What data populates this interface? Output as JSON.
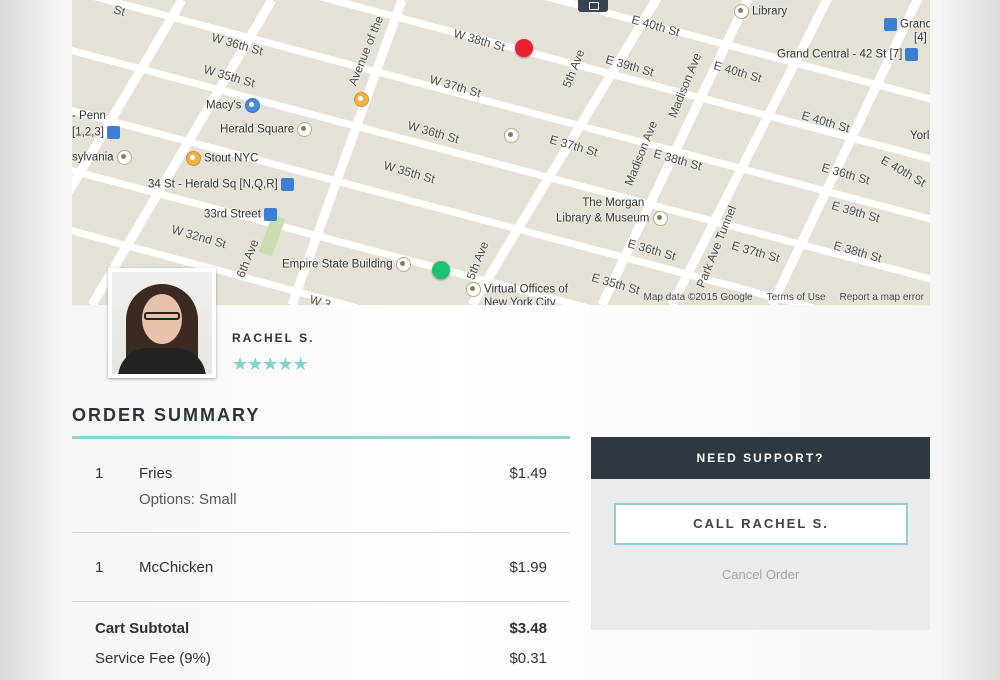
{
  "map": {
    "streets": [
      "W 36th St",
      "W 35th St",
      "W 38th St",
      "W 37th St",
      "W 36th St",
      "W 35th St",
      "W 32nd St",
      "W 3",
      "Avenue of the",
      "5th Ave",
      "5th Ave",
      "E 40th St",
      "E 40th St",
      "E 39th St",
      "E 38th St",
      "E 37th St",
      "Madison Ave",
      "Madison Ave",
      "Park Ave Tunnel",
      "E 36th St",
      "E 35th St",
      "E 37th St",
      "E 40th St",
      "E 39th St",
      "E 38th St",
      "E 36th St",
      "E 40th St",
      "6th Ave",
      "St"
    ],
    "places": {
      "library": "Library",
      "grand_central": "Grand Central - 42 St",
      "grand_central_short": "Grand Co",
      "penn": "- Penn",
      "penn_lines": "[1,2,3]",
      "sylvania": "sylvania",
      "macys": "Macy's",
      "herald_square": "Herald Square",
      "stout": "Stout NYC",
      "herald_sq_station": "34 St - Herald Sq [N,Q,R]",
      "street_33": "33rd Street",
      "morgan_1": "The Morgan",
      "morgan_2": "Library & Museum",
      "empire": "Empire State Building",
      "virtual_1": "Virtual Offices of",
      "virtual_2": "New York City",
      "york": "Yorl",
      "gc_line": "[7]",
      "gc_line2": "[4]"
    },
    "footer": {
      "data": "Map data ©2015 Google",
      "terms": "Terms of Use",
      "report": "Report a map error"
    },
    "pins": {
      "pickup_color": "#e8202f",
      "dropoff_color": "#1ec173"
    }
  },
  "driver": {
    "name": "RACHEL S.",
    "stars": "★★★★★",
    "rating": 5
  },
  "order": {
    "title": "ORDER SUMMARY",
    "items": [
      {
        "qty": "1",
        "name": "Fries",
        "options": "Options: Small",
        "price": "$1.49"
      },
      {
        "qty": "1",
        "name": "McChicken",
        "price": "$1.99"
      }
    ],
    "totals": [
      {
        "label": "Cart Subtotal",
        "value": "$3.48"
      },
      {
        "label": "Service Fee (9%)",
        "value": "$0.31"
      }
    ]
  },
  "support": {
    "title": "NEED SUPPORT?",
    "call_label": "CALL RACHEL S.",
    "cancel_label": "Cancel Order"
  },
  "colors": {
    "accent": "#8fd1ce",
    "dark": "#2e3841",
    "star": "#7fd4d0"
  }
}
